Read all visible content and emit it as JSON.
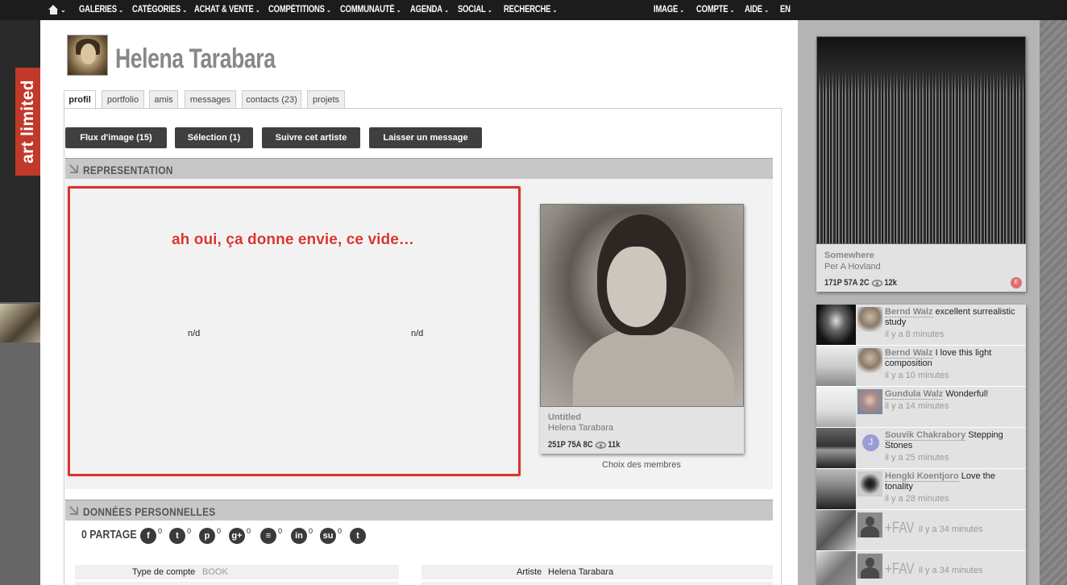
{
  "nav": {
    "left": [
      "GALERIES",
      "CATÉGORIES",
      "ACHAT & VENTE",
      "COMPÉTITIONS",
      "COMMUNAUTÉ",
      "AGENDA",
      "SOCIAL",
      "RECHERCHE"
    ],
    "right": [
      "IMAGE",
      "COMPTE",
      "AIDE"
    ],
    "lang": "EN"
  },
  "brand": "art limited",
  "profile": {
    "name": "Helena Tarabara",
    "tabs": [
      "profil",
      "portfolio",
      "amis",
      "messages",
      "contacts (23)",
      "projets"
    ],
    "active_tab": "profil"
  },
  "actions": [
    "Flux d'image (15)",
    "Sélection (1)",
    "Suivre cet artiste",
    "Laisser un message"
  ],
  "representation": {
    "title": "REPRESENTATION",
    "annotation": "ah oui, ça donne envie, ce vide…",
    "nd1": "n/d",
    "nd2": "n/d",
    "card": {
      "title": "Untitled",
      "author": "Helena Tarabara",
      "stats": "251P 75A 8C",
      "views": "11k",
      "caption": "Choix des membres"
    }
  },
  "personal": {
    "title": "DONNÉES PERSONNELLES",
    "share_label": "0 PARTAGE",
    "share_icons": [
      {
        "icon": "facebook-icon",
        "glyph": "f",
        "count": "0"
      },
      {
        "icon": "twitter-icon",
        "glyph": "t",
        "count": "0"
      },
      {
        "icon": "pinterest-icon",
        "glyph": "p",
        "count": "0"
      },
      {
        "icon": "googleplus-icon",
        "glyph": "g+",
        "count": "0"
      },
      {
        "icon": "buffer-icon",
        "glyph": "≡",
        "count": "0"
      },
      {
        "icon": "linkedin-icon",
        "glyph": "in",
        "count": "0"
      },
      {
        "icon": "stumbleupon-icon",
        "glyph": "su",
        "count": "0"
      },
      {
        "icon": "tumblr-icon",
        "glyph": "t",
        "count": ""
      }
    ],
    "account_type_label": "Type de compte",
    "account_type_value": "BOOK",
    "artist_label": "Artiste",
    "artist_value": "Helena Tarabara"
  },
  "featured": {
    "title": "Somewhere",
    "author": "Per A Hovland",
    "stats": "171P 57A 2C",
    "views": "12k",
    "badge": "E"
  },
  "feed": [
    {
      "user": "Bernd Walz",
      "text": "excellent surrealistic study",
      "time": "il y a 8 minutes"
    },
    {
      "user": "Bernd Walz",
      "text": "I love this light composition",
      "time": "il y a 10 minutes"
    },
    {
      "user": "Gundula Walz",
      "text": "Wonderful!",
      "time": "il y a 14 minutes"
    },
    {
      "user": "Souvik Chakrabory",
      "text": "Stepping Stones",
      "time": "il y a 25 minutes",
      "initial": "J"
    },
    {
      "user": "Hengki Koentjoro",
      "text": "Love the tonality",
      "time": "il y a 28 minutes"
    }
  ],
  "feed_fav": [
    {
      "label": "+FAV",
      "time": "il y a 34 minutes"
    },
    {
      "label": "+FAV",
      "time": "il y a 34 minutes"
    }
  ],
  "colors": {
    "accent_red": "#d9352c",
    "nav_bg": "#1c1c1c",
    "button_bg": "#3f3f3f",
    "brand_red": "#c0392b"
  }
}
